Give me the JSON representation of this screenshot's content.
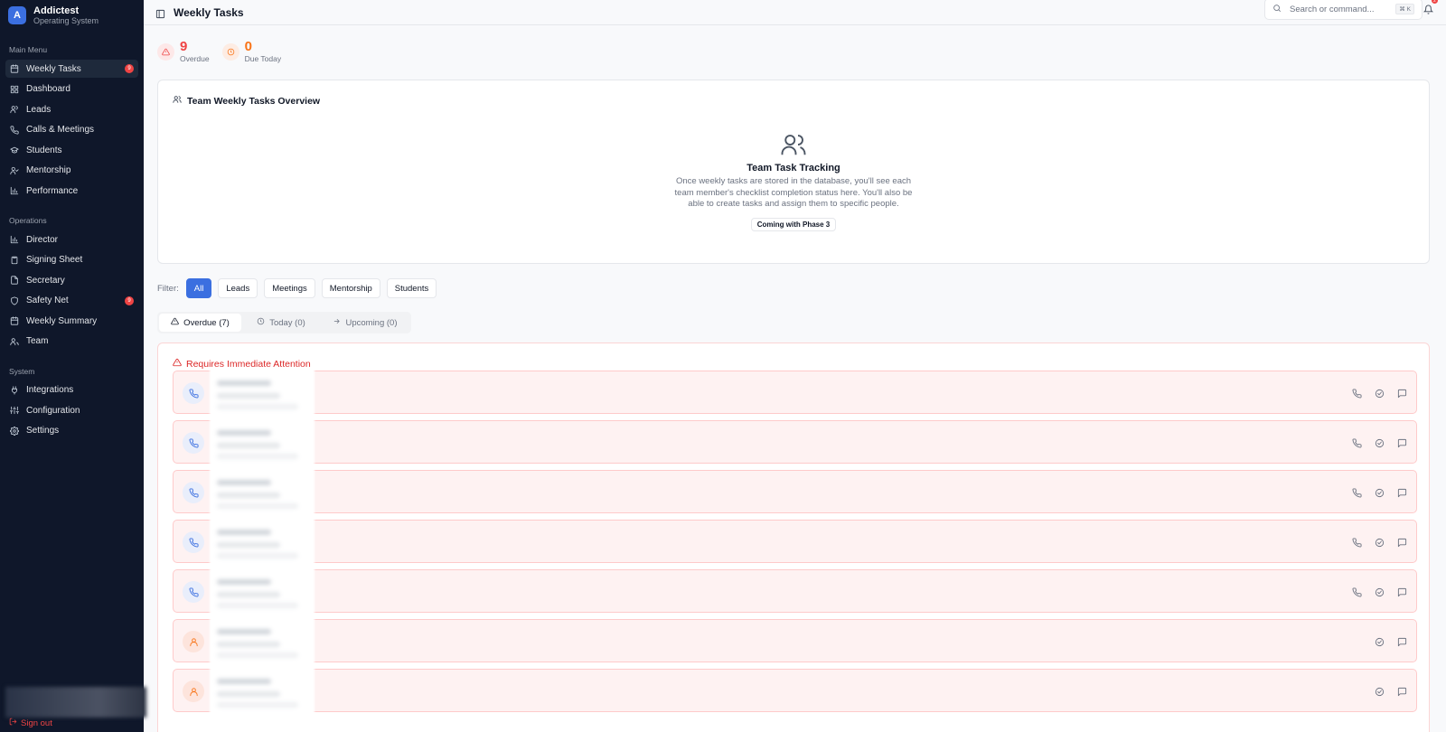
{
  "brand": {
    "logo_letter": "A",
    "name": "Addictest",
    "subtitle": "Operating System"
  },
  "sidebar": {
    "sections": [
      {
        "title": "Main Menu",
        "items": [
          {
            "label": "Weekly Tasks",
            "icon": "calendar-icon",
            "badge": "9",
            "active": true
          },
          {
            "label": "Dashboard",
            "icon": "dashboard-icon"
          },
          {
            "label": "Leads",
            "icon": "users-icon"
          },
          {
            "label": "Calls & Meetings",
            "icon": "phone-icon"
          },
          {
            "label": "Students",
            "icon": "graduation-cap-icon"
          },
          {
            "label": "Mentorship",
            "icon": "user-check-icon"
          },
          {
            "label": "Performance",
            "icon": "bar-chart-icon"
          }
        ]
      },
      {
        "title": "Operations",
        "items": [
          {
            "label": "Director",
            "icon": "bar-chart-icon"
          },
          {
            "label": "Signing Sheet",
            "icon": "clipboard-icon"
          },
          {
            "label": "Secretary",
            "icon": "file-icon"
          },
          {
            "label": "Safety Net",
            "icon": "shield-icon",
            "badge": "9"
          },
          {
            "label": "Weekly Summary",
            "icon": "calendar-icon"
          },
          {
            "label": "Team",
            "icon": "team-icon"
          }
        ]
      },
      {
        "title": "System",
        "items": [
          {
            "label": "Integrations",
            "icon": "plug-icon"
          },
          {
            "label": "Configuration",
            "icon": "sliders-icon"
          },
          {
            "label": "Settings",
            "icon": "gear-icon"
          }
        ]
      }
    ],
    "signout_label": "Sign out"
  },
  "header": {
    "title": "Weekly Tasks",
    "search_placeholder": "Search or command...",
    "shortcut": "⌘ K",
    "notification_count": "2"
  },
  "stats": [
    {
      "value": "9",
      "label": "Overdue",
      "icon": "alert-triangle-icon",
      "color": "#ef4444"
    },
    {
      "value": "0",
      "label": "Due Today",
      "icon": "clock-icon",
      "color": "#f97316"
    }
  ],
  "overview": {
    "title": "Team Weekly Tasks Overview",
    "empty_title": "Team Task Tracking",
    "empty_desc": "Once weekly tasks are stored in the database, you'll see each team member's checklist completion status here. You'll also be able to create tasks and assign them to specific people.",
    "phase_badge": "Coming with Phase 3"
  },
  "filters": {
    "label": "Filter:",
    "options": [
      "All",
      "Leads",
      "Meetings",
      "Mentorship",
      "Students"
    ],
    "selected": "All"
  },
  "tabs": [
    {
      "label": "Overdue (7)",
      "icon": "alert-triangle-icon",
      "active": true
    },
    {
      "label": "Today (0)",
      "icon": "clock-icon"
    },
    {
      "label": "Upcoming (0)",
      "icon": "arrow-right-icon"
    }
  ],
  "attention": {
    "title": "Requires Immediate Attention",
    "rows": [
      {
        "type": "phone"
      },
      {
        "type": "phone"
      },
      {
        "type": "phone"
      },
      {
        "type": "phone"
      },
      {
        "type": "phone"
      },
      {
        "type": "person"
      },
      {
        "type": "person"
      }
    ]
  },
  "colors": {
    "sidebar_bg": "#0f172a",
    "accent": "#3b6fe0",
    "danger": "#ef4444",
    "warning": "#f97316"
  }
}
